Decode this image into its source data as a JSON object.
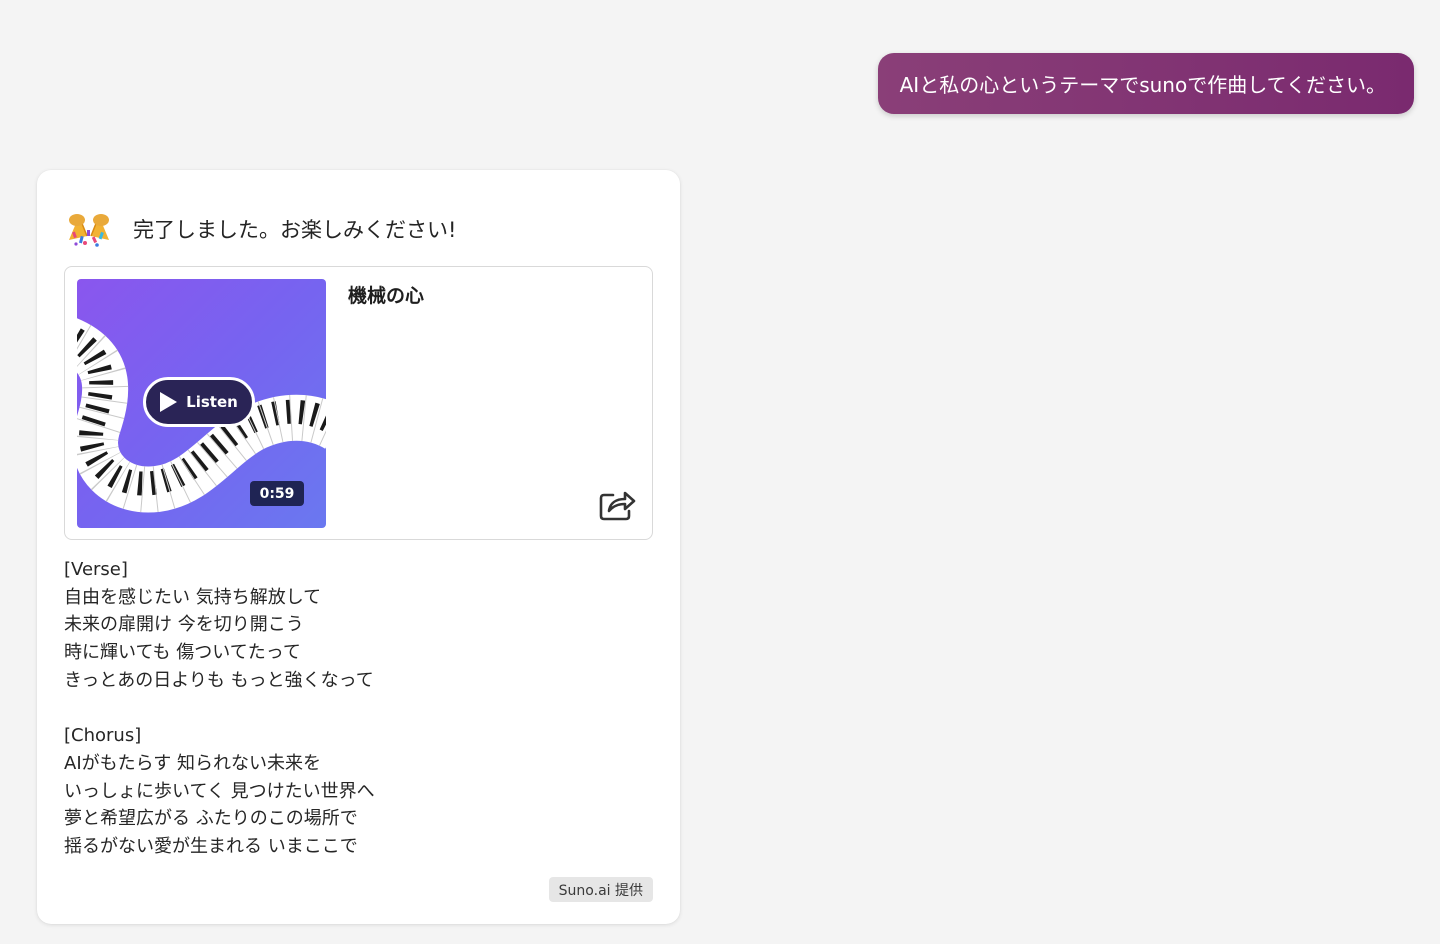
{
  "user_message": {
    "text": "AIと私の心というテーマでsunoで作曲してください。"
  },
  "response": {
    "header_icon": "confetti-icon",
    "header_text": "完了しました。お楽しみください!",
    "song": {
      "title": "機械の心",
      "listen_label": "Listen",
      "duration": "0:59",
      "share_icon": "share-icon"
    },
    "lyrics": {
      "verse_tag": "[Verse]",
      "verse": [
        "自由を感じたい 気持ち解放して",
        "未来の扉開け 今を切り開こう",
        "時に輝いても 傷ついてたって",
        "きっとあの日よりも もっと強くなって"
      ],
      "chorus_tag": "[Chorus]",
      "chorus": [
        "AIがもたらす 知られない未来を",
        "いっしょに歩いてく 見つけたい世界へ",
        "夢と希望広がる ふたりのこの場所で",
        "揺るがない愛が生まれる いまここで"
      ]
    },
    "provider": "Suno.ai 提供"
  },
  "colors": {
    "user_bubble": "#7a2a6f",
    "cover_start": "#8a56ee",
    "cover_end": "#6a78f0",
    "listen_button": "#2a2456"
  }
}
